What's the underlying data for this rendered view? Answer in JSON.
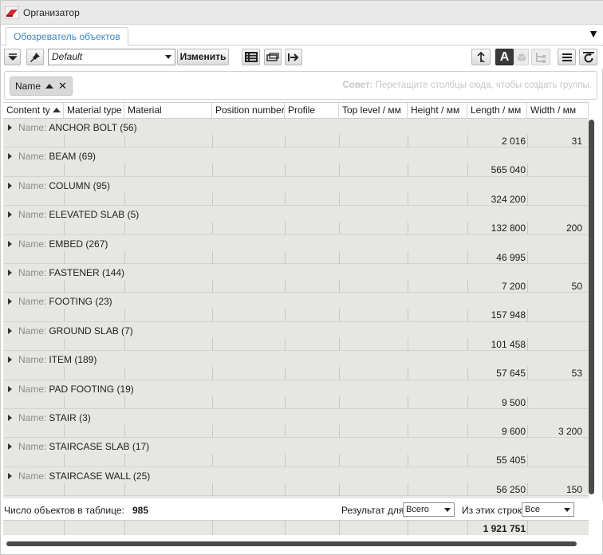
{
  "window": {
    "title": "Организатор"
  },
  "tabs": [
    {
      "label": "Обозреватель объектов"
    }
  ],
  "toolbar": {
    "view_value": "Default",
    "edit_label": "Изменить",
    "text_mode_label": "A"
  },
  "group_panel": {
    "chip_label": "Name",
    "hint_bold": "Совет:",
    "hint_text": " Перетащите столбцы сюда, чтобы создать группы."
  },
  "columns": [
    "Content ty",
    "Material type",
    "Material",
    "Position number",
    "Profile",
    "Top level / мм",
    "Height / мм",
    "Length / мм",
    "Width / мм"
  ],
  "group_label": "Name:",
  "groups": [
    {
      "name": "ANCHOR BOLT (56)",
      "length": "2 016",
      "width": "31"
    },
    {
      "name": "BEAM (69)",
      "length": "565 040",
      "width": ""
    },
    {
      "name": "COLUMN (95)",
      "length": "324 200",
      "width": ""
    },
    {
      "name": "ELEVATED SLAB (5)",
      "length": "132 800",
      "width": "200"
    },
    {
      "name": "EMBED (267)",
      "length": "46 995",
      "width": ""
    },
    {
      "name": "FASTENER (144)",
      "length": "7 200",
      "width": "50"
    },
    {
      "name": "FOOTING (23)",
      "length": "157 948",
      "width": ""
    },
    {
      "name": "GROUND SLAB (7)",
      "length": "101 458",
      "width": ""
    },
    {
      "name": "ITEM (189)",
      "length": "57 645",
      "width": "53"
    },
    {
      "name": "PAD FOOTING (19)",
      "length": "9 500",
      "width": ""
    },
    {
      "name": "STAIR (3)",
      "length": "9 600",
      "width": "3 200"
    },
    {
      "name": "STAIRCASE SLAB (17)",
      "length": "55 405",
      "width": ""
    },
    {
      "name": "STAIRCASE WALL (25)",
      "length": "56 250",
      "width": "150"
    }
  ],
  "footer": {
    "count_label": "Число объектов в таблице:",
    "count_value": "985",
    "result_label": "Результат для:",
    "result_value": "Всего",
    "rows_label": "Из этих строк:",
    "rows_value": "Все"
  },
  "totals": {
    "length_sum": "1 921 751"
  },
  "colors": {
    "tab_text": "#3b84c4",
    "grid_bg": "#e6e6e3",
    "logo": "#d7262b"
  }
}
